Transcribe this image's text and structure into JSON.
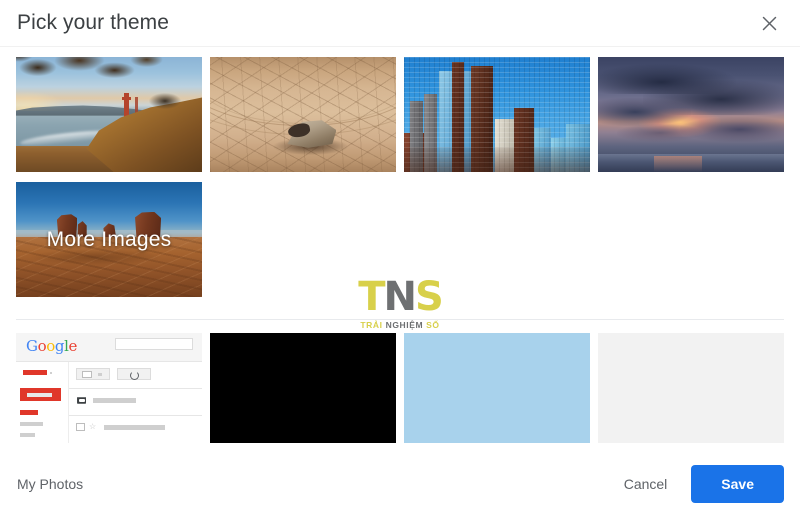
{
  "dialog": {
    "title": "Pick your theme",
    "close_icon": "close-icon"
  },
  "photo_themes": [
    {
      "name": "golden-gate-sunset",
      "label": ""
    },
    {
      "name": "cracked-desert-playa-rock",
      "label": ""
    },
    {
      "name": "city-skyline-blue-glass",
      "label": ""
    },
    {
      "name": "stormy-sunset-clouds-ocean",
      "label": ""
    },
    {
      "name": "monument-valley-desert",
      "label": "More Images"
    }
  ],
  "color_themes": [
    {
      "name": "gmail-default-light",
      "selected": true,
      "color": "#ffffff"
    },
    {
      "name": "solid-black",
      "selected": false,
      "color": "#000000"
    },
    {
      "name": "solid-light-blue",
      "selected": false,
      "color": "#a8d2ec"
    },
    {
      "name": "solid-light-gray",
      "selected": false,
      "color": "#f2f2f2"
    }
  ],
  "gmail_preview": {
    "logo": {
      "g1": "G",
      "o1": "o",
      "o2": "o",
      "g2": "g",
      "l": "l",
      "e": "e"
    }
  },
  "watermark": {
    "letters_t": "T",
    "letters_n": "N",
    "letters_s": "S",
    "sub_1": "TRẢI ",
    "sub_2": "NGHIỆM ",
    "sub_3": "SỐ"
  },
  "footer": {
    "my_photos_label": "My Photos",
    "cancel_label": "Cancel",
    "save_label": "Save"
  },
  "colors": {
    "accent": "#1a73e8",
    "selection_border": "#4285f4",
    "text_primary": "#3c4043",
    "text_secondary": "#5f6368",
    "divider": "#e8eaed",
    "watermark_yellow": "#d8d04a",
    "watermark_gray": "#6e7072"
  }
}
